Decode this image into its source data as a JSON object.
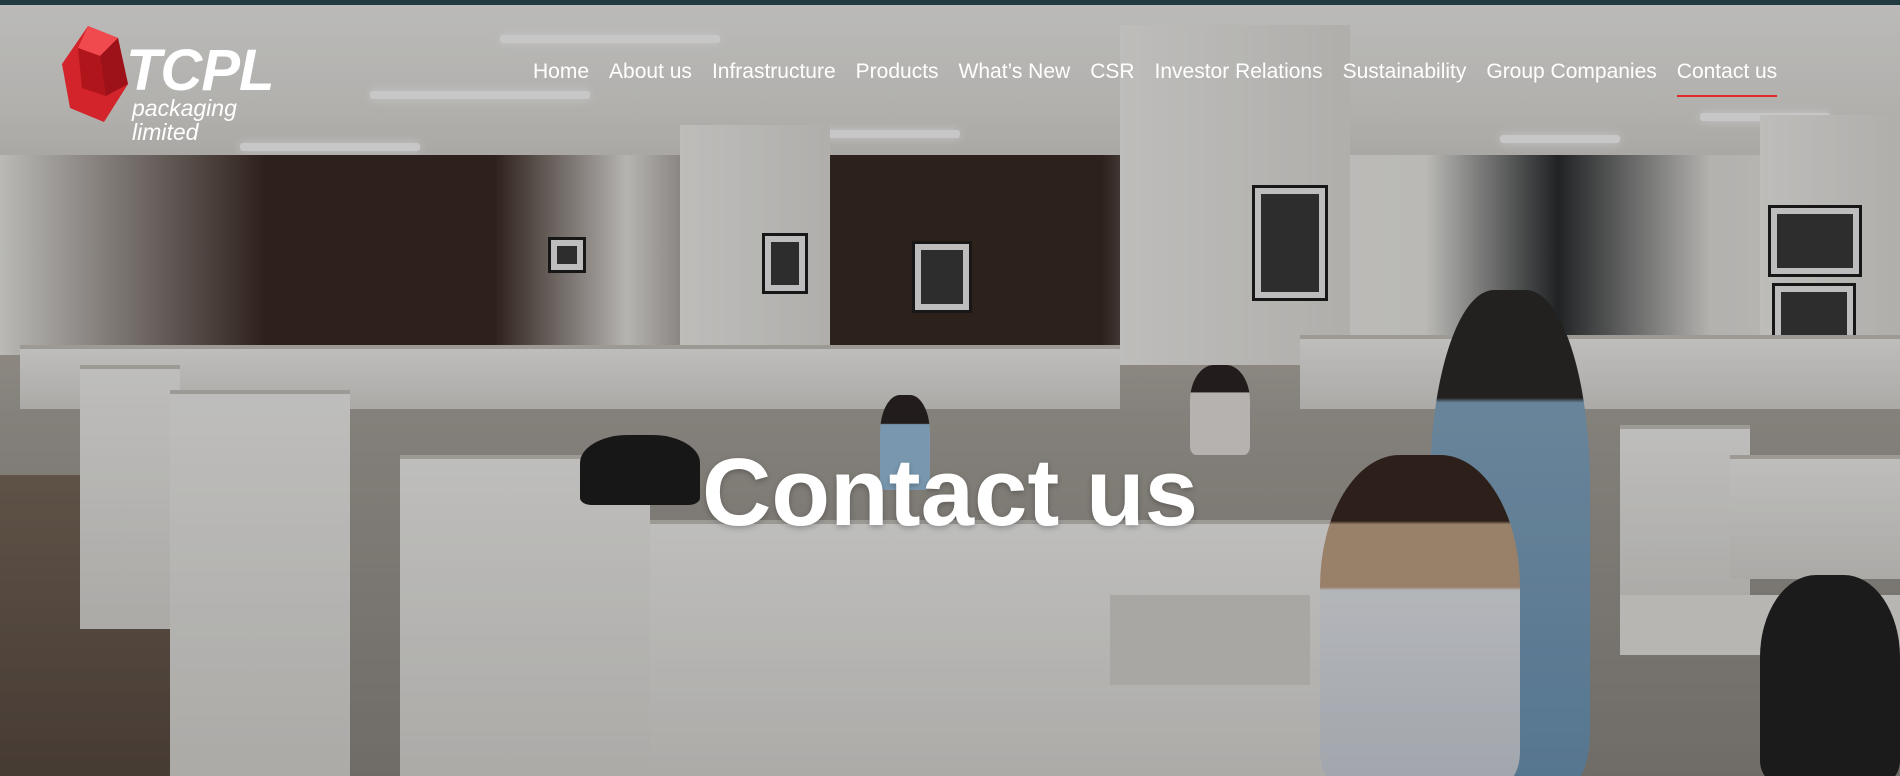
{
  "brand": {
    "name": "TCPL",
    "tagline": "packaging limited",
    "logo_color": "#d3232b"
  },
  "nav": {
    "items": [
      {
        "label": "Home"
      },
      {
        "label": "About us"
      },
      {
        "label": "Infrastructure"
      },
      {
        "label": "Products"
      },
      {
        "label": "What’s New"
      },
      {
        "label": "CSR"
      },
      {
        "label": "Investor Relations"
      },
      {
        "label": "Sustainability"
      },
      {
        "label": "Group Companies"
      },
      {
        "label": "Contact us",
        "active": true
      }
    ],
    "active_underline_color": "#e02a2a"
  },
  "hero": {
    "title": "Contact us"
  },
  "colors": {
    "top_bar": "#203a40",
    "text": "#ffffff"
  }
}
